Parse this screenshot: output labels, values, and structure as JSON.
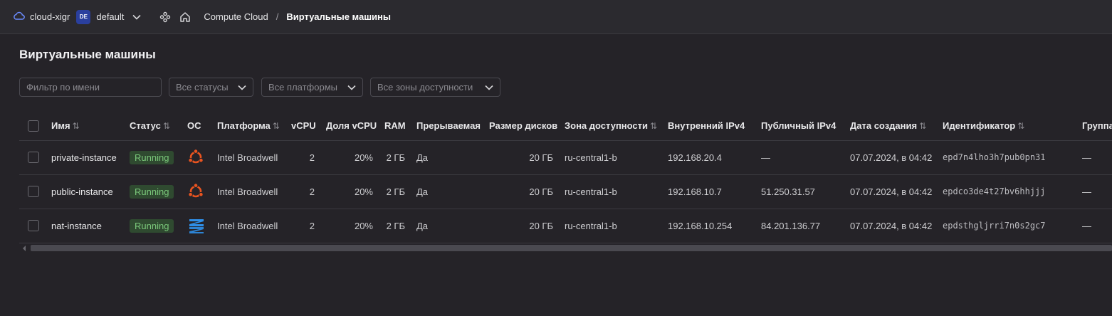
{
  "topbar": {
    "cloud_name": "cloud-xigr",
    "folder_badge": "DE",
    "folder_name": "default",
    "crumb_service": "Compute Cloud",
    "crumb_separator": "/",
    "crumb_page": "Виртуальные машины"
  },
  "page": {
    "title": "Виртуальные машины"
  },
  "filters": {
    "name_placeholder": "Фильтр по имени",
    "status": "Все статусы",
    "platform": "Все платформы",
    "zone": "Все зоны доступности"
  },
  "table": {
    "columns": {
      "name": "Имя",
      "status": "Статус",
      "os": "ОС",
      "platform": "Платформа",
      "vcpu": "vCPU",
      "vcpu_share": "Доля vCPU",
      "ram": "RAM",
      "preemptible": "Прерываемая",
      "disk": "Размер дисков",
      "zone": "Зона доступности",
      "ip_internal": "Внутренний IPv4",
      "ip_public": "Публичный IPv4",
      "created": "Дата создания",
      "id": "Идентификатор",
      "group": "Группа"
    },
    "rows": [
      {
        "name": "private-instance",
        "status": "Running",
        "os": "ubuntu",
        "platform": "Intel Broadwell",
        "vcpu": "2",
        "vcpu_share": "20%",
        "ram": "2 ГБ",
        "preemptible": "Да",
        "disk": "20 ГБ",
        "zone": "ru-central1-b",
        "ip_internal": "192.168.20.4",
        "ip_public": "—",
        "created": "07.07.2024, в 04:42",
        "id": "epd7n4lho3h7pub0pn31",
        "group": "—"
      },
      {
        "name": "public-instance",
        "status": "Running",
        "os": "ubuntu",
        "platform": "Intel Broadwell",
        "vcpu": "2",
        "vcpu_share": "20%",
        "ram": "2 ГБ",
        "preemptible": "Да",
        "disk": "20 ГБ",
        "zone": "ru-central1-b",
        "ip_internal": "192.168.10.7",
        "ip_public": "51.250.31.57",
        "created": "07.07.2024, в 04:42",
        "id": "epdco3de4t27bv6hhjjj",
        "group": "—"
      },
      {
        "name": "nat-instance",
        "status": "Running",
        "os": "nat",
        "platform": "Intel Broadwell",
        "vcpu": "2",
        "vcpu_share": "20%",
        "ram": "2 ГБ",
        "preemptible": "Да",
        "disk": "20 ГБ",
        "zone": "ru-central1-b",
        "ip_internal": "192.168.10.254",
        "ip_public": "84.201.136.77",
        "created": "07.07.2024, в 04:42",
        "id": "epdsthgljrri7n0s2gc7",
        "group": "—"
      }
    ]
  },
  "colors": {
    "background": "#252328",
    "running_bg": "#2f4a30",
    "running_text": "#7bc97b",
    "ubuntu_orange": "#e95420",
    "nat_blue": "#2f8fe8"
  }
}
